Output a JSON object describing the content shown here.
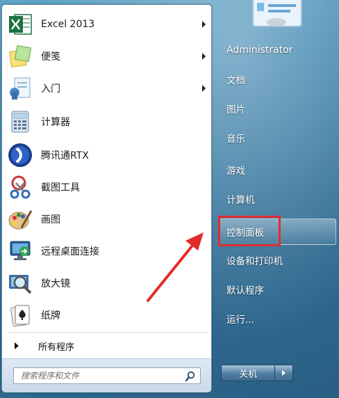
{
  "colors": {
    "highlight_red": "#e32b2b",
    "panel_blue": "#3f86b0"
  },
  "programs": [
    {
      "label": "Excel 2013",
      "icon": "excel-icon",
      "has_submenu": true
    },
    {
      "label": "便笺",
      "icon": "sticky-notes-icon",
      "has_submenu": true
    },
    {
      "label": "入门",
      "icon": "getting-started-icon",
      "has_submenu": true
    },
    {
      "label": "计算器",
      "icon": "calculator-icon",
      "has_submenu": false
    },
    {
      "label": "腾讯通RTX",
      "icon": "rtx-icon",
      "has_submenu": false
    },
    {
      "label": "截图工具",
      "icon": "snipping-tool-icon",
      "has_submenu": false
    },
    {
      "label": "画图",
      "icon": "paint-icon",
      "has_submenu": false
    },
    {
      "label": "远程桌面连接",
      "icon": "remote-desktop-icon",
      "has_submenu": false
    },
    {
      "label": "放大镜",
      "icon": "magnifier-icon",
      "has_submenu": false
    },
    {
      "label": "纸牌",
      "icon": "solitaire-icon",
      "has_submenu": false
    }
  ],
  "all_programs": "所有程序",
  "search": {
    "placeholder": "搜索程序和文件"
  },
  "right_menu": {
    "user": "Administrator",
    "documents": "文档",
    "pictures": "图片",
    "music": "音乐",
    "games": "游戏",
    "computer": "计算机",
    "control_panel": "控制面板",
    "devices_printers": "设备和打印机",
    "default_programs": "默认程序",
    "run": "运行..."
  },
  "shutdown": {
    "label": "关机"
  }
}
